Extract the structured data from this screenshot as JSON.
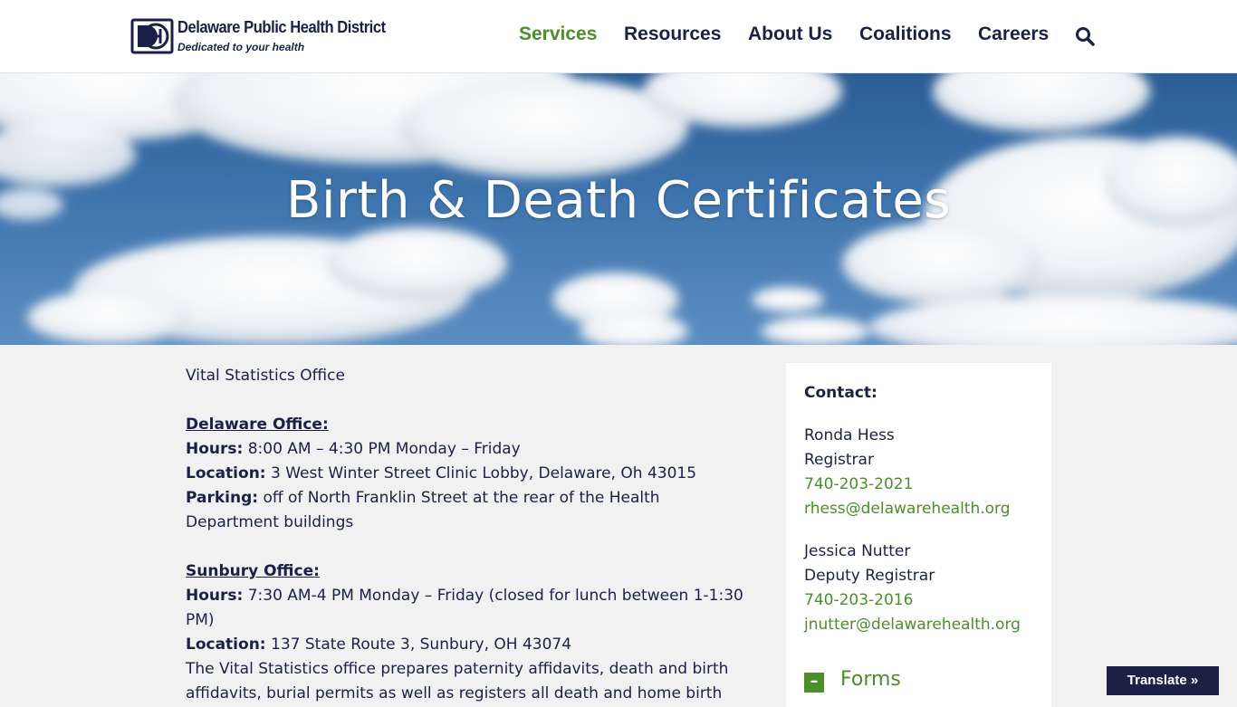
{
  "header": {
    "logo_name": "Delaware Public Health District",
    "logo_tagline": "Dedicated to your health",
    "nav": [
      "Services",
      "Resources",
      "About Us",
      "Coalitions",
      "Careers"
    ]
  },
  "hero": {
    "title": "Birth & Death Certificates"
  },
  "main": {
    "intro": "Vital Statistics Office",
    "delaware": {
      "heading": "Delaware Office:",
      "hours_label": "Hours:",
      "hours": " 8:00 AM – 4:30 PM Monday – Friday",
      "location_label": "Location:",
      "location": " 3 West Winter Street Clinic Lobby, Delaware, Oh 43015",
      "parking_label": "Parking:",
      "parking": " off of North Franklin Street at the rear of the Health Department buildings"
    },
    "sunbury": {
      "heading": "Sunbury Office:",
      "hours_label": "Hours:",
      "hours": " 7:30 AM-4 PM Monday – Friday (closed for lunch between 1-1:30 PM)",
      "location_label": "Location:",
      "location": " 137 State Route 3, Sunbury, OH 43074"
    },
    "description": "The Vital Statistics office prepares paternity affidavits, death and birth affidavits, burial permits as well as registers all death and home birth"
  },
  "sidebar": {
    "heading": "Contact:",
    "contacts": [
      {
        "name": "Ronda Hess",
        "title": "Registrar",
        "phone": "740-203-2021",
        "email": "rhess@delawarehealth.org"
      },
      {
        "name": "Jessica Nutter",
        "title": "Deputy Registrar",
        "phone": "740-203-2016",
        "email": "jnutter@delawarehealth.org"
      }
    ],
    "forms_toggle": "–",
    "forms_label": "Forms"
  },
  "translate": {
    "label": "Translate »"
  },
  "colors": {
    "navy": "#1b2146",
    "green": "#4a8f2a",
    "background": "#f1f1f1"
  },
  "icons": {
    "search": "search-icon",
    "logo": "dph-logo-icon"
  }
}
